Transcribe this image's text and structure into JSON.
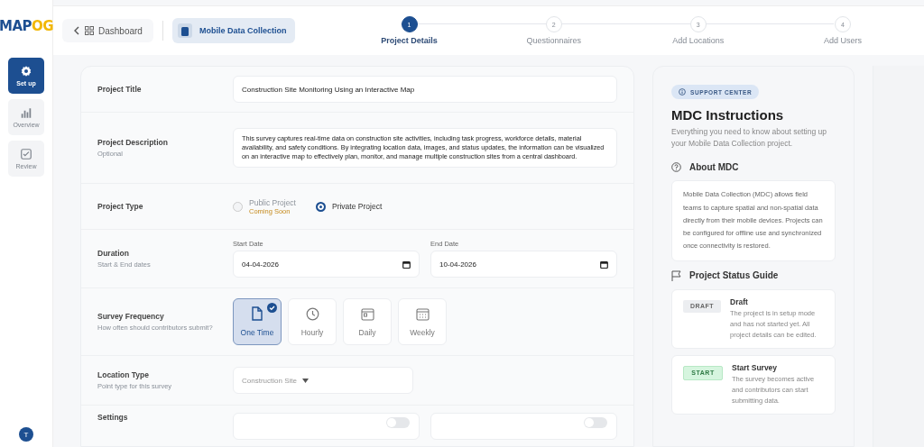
{
  "logo": {
    "primary": "MAP",
    "accent": "OG"
  },
  "sidebar": {
    "items": [
      {
        "label": "Set up",
        "kind": "gear",
        "selected": true
      },
      {
        "label": "Overview",
        "kind": "chart",
        "selected": false
      },
      {
        "label": "Review",
        "kind": "check",
        "selected": false
      }
    ],
    "avatar": "T"
  },
  "topbar": {
    "back": "Dashboard",
    "module": "Mobile Data Collection"
  },
  "steps": [
    {
      "number": "1",
      "label": "Project Details",
      "selected": true
    },
    {
      "number": "2",
      "label": "Questionnaires",
      "selected": false
    },
    {
      "number": "3",
      "label": "Add Locations",
      "selected": false
    },
    {
      "number": "4",
      "label": "Add Users",
      "selected": false
    }
  ],
  "form": {
    "title": {
      "label": "Project Title",
      "value": "Construction Site Monitoring Using an Interactive Map"
    },
    "description": {
      "label": "Project Description",
      "hint": "Optional",
      "value": "This survey captures real-time data on construction site activities, including task progress, workforce details, material availability, and safety conditions. By integrating location data, images, and status updates, the information can be visualized on an interactive map to effectively plan, monitor, and manage multiple construction sites from a central dashboard."
    },
    "project_type": {
      "label": "Project Type",
      "options": [
        {
          "label": "Public Project",
          "note": "Coming Soon",
          "disabled": true,
          "selected": false
        },
        {
          "label": "Private Project",
          "disabled": false,
          "selected": true
        }
      ]
    },
    "duration": {
      "label": "Duration",
      "hint": "Start & End dates",
      "start": {
        "label": "Start Date",
        "value": "04-04-2026"
      },
      "end": {
        "label": "End Date",
        "value": "10-04-2026"
      }
    },
    "frequency": {
      "label": "Survey Frequency",
      "hint": "How often should contributors submit?",
      "options": [
        {
          "label": "One Time",
          "kind": "document",
          "selected": true
        },
        {
          "label": "Hourly",
          "kind": "clock",
          "selected": false
        },
        {
          "label": "Daily",
          "kind": "calendar",
          "selected": false
        },
        {
          "label": "Weekly",
          "kind": "calendar-grid",
          "selected": false
        }
      ]
    },
    "location_type": {
      "label": "Location Type",
      "hint": "Point type for this survey",
      "value": "Construction Site"
    },
    "settings": {
      "label": "Settings",
      "toggles": [
        {
          "on": false
        },
        {
          "on": false
        }
      ]
    }
  },
  "support": {
    "badge": "SUPPORT CENTER",
    "title": "MDC Instructions",
    "subtitle": "Everything you need to know about setting up your Mobile Data Collection project.",
    "about": {
      "heading": "About MDC",
      "text": "Mobile Data Collection (MDC) allows field teams to capture spatial and non-spatial data directly from their mobile devices. Projects can be configured for offline use and synchronized once connectivity is restored."
    },
    "status_guide": {
      "heading": "Project Status Guide",
      "items": [
        {
          "badge": "DRAFT",
          "kind": "draft",
          "title": "Draft",
          "text": "The project is in setup mode and has not started yet. All project details can be edited."
        },
        {
          "badge": "START",
          "kind": "start",
          "title": "Start Survey",
          "text": "The survey becomes active and contributors can start submitting data."
        }
      ]
    }
  }
}
